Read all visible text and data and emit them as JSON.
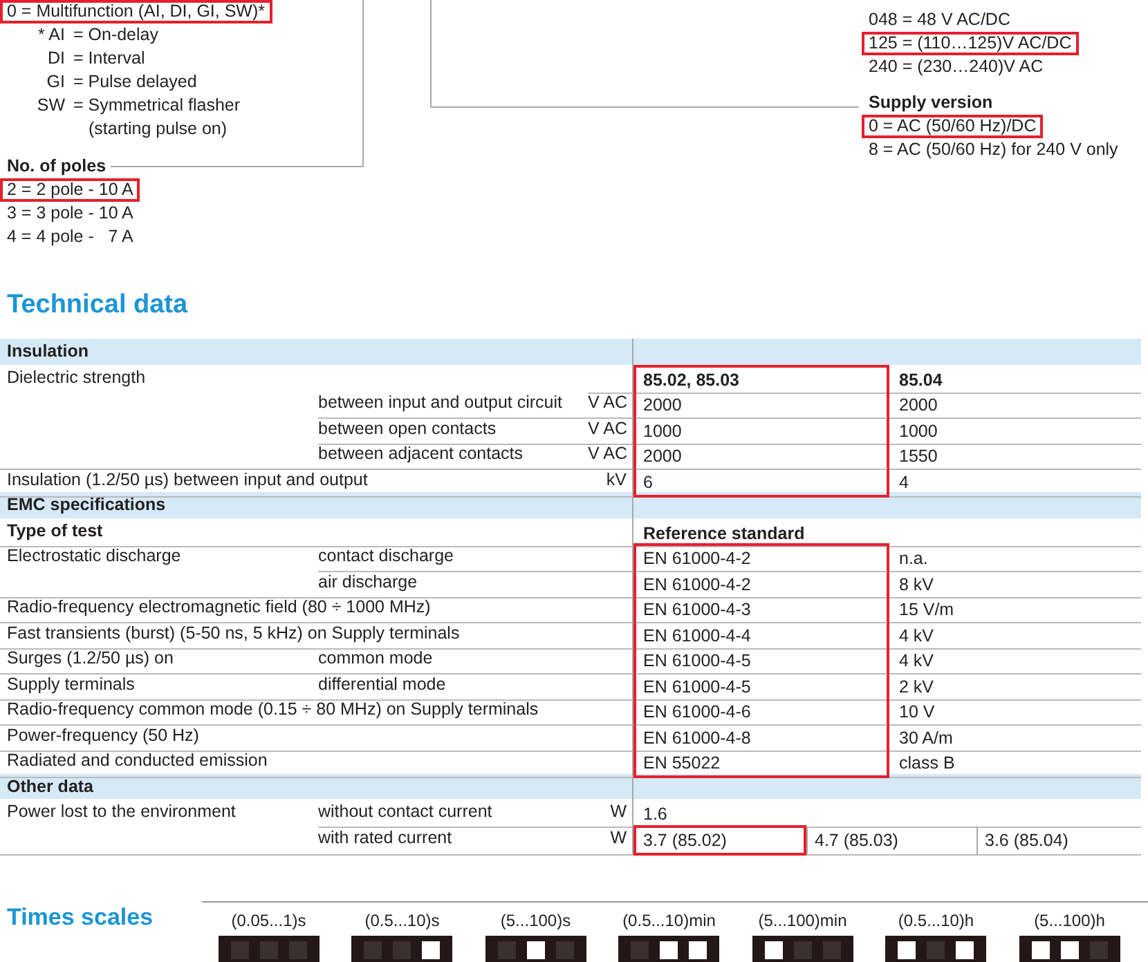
{
  "function_options": [
    {
      "text": "0 = Multifunction (AI, DI, GI, SW)*",
      "highlighted": true
    }
  ],
  "function_notes": [
    {
      "code": "* AI",
      "meaning": "= On-delay"
    },
    {
      "code": "DI",
      "meaning": "= Interval"
    },
    {
      "code": "GI",
      "meaning": "= Pulse delayed"
    },
    {
      "code": "SW",
      "meaning": "= Symmetrical flasher",
      "continuation": "(starting pulse on)"
    }
  ],
  "poles": {
    "title": "No. of poles",
    "options": [
      {
        "text": "2 = 2 pole - 10 A",
        "highlighted": true
      },
      {
        "text": "3 = 3 pole - 10 A",
        "highlighted": false
      },
      {
        "text": "4 = 4 pole -   7 A",
        "highlighted": false
      }
    ]
  },
  "voltage_options": [
    {
      "text": "048 = 48 V AC/DC",
      "highlighted": false
    },
    {
      "text": "125 = (110…125)V AC/DC",
      "highlighted": true
    },
    {
      "text": "240 = (230…240)V AC",
      "highlighted": false
    }
  ],
  "supply_version": {
    "title": "Supply version",
    "options": [
      {
        "text": "0 = AC (50/60 Hz)/DC",
        "highlighted": true
      },
      {
        "text": "8 = AC (50/60 Hz) for 240 V only",
        "highlighted": false
      }
    ]
  },
  "technical_data": {
    "title": "Technical data",
    "rows": [
      {
        "kind": "section",
        "label": "Insulation"
      },
      {
        "kind": "columns",
        "label": "Dielectric strength",
        "values": [
          {
            "text": "85.02, 85.03",
            "highlighted": true
          },
          {
            "text": "85.04",
            "highlighted": false
          }
        ]
      },
      {
        "kind": "data",
        "sub": "between input and output circuit",
        "unit": "V AC",
        "values": [
          {
            "text": "2000",
            "highlighted": true
          },
          {
            "text": "2000",
            "highlighted": false
          }
        ]
      },
      {
        "kind": "data",
        "sub": "between open contacts",
        "unit": "V AC",
        "values": [
          {
            "text": "1000",
            "highlighted": true
          },
          {
            "text": "1000",
            "highlighted": false
          }
        ]
      },
      {
        "kind": "data",
        "sub": "between adjacent contacts",
        "unit": "V AC",
        "values": [
          {
            "text": "2000",
            "highlighted": true
          },
          {
            "text": "1550",
            "highlighted": false
          }
        ]
      },
      {
        "kind": "data",
        "label": "Insulation (1.2/50 µs) between input and output",
        "unit": "kV",
        "values": [
          {
            "text": "6",
            "highlighted": true
          },
          {
            "text": "4",
            "highlighted": false
          }
        ]
      },
      {
        "kind": "section",
        "label": "EMC specifications"
      },
      {
        "kind": "heading",
        "label": "Type of test",
        "values": [
          {
            "text": "Reference standard",
            "highlighted": false
          }
        ]
      },
      {
        "kind": "data",
        "label": "Electrostatic discharge",
        "sub": "contact discharge",
        "values": [
          {
            "text": "EN 61000-4-2",
            "highlighted": true
          },
          {
            "text": "n.a.",
            "highlighted": false
          }
        ]
      },
      {
        "kind": "data",
        "sub": "air discharge",
        "values": [
          {
            "text": "EN 61000-4-2",
            "highlighted": true
          },
          {
            "text": "8 kV",
            "highlighted": false
          }
        ]
      },
      {
        "kind": "data",
        "label": "Radio-frequency electromagnetic field (80 ÷ 1000 MHz)",
        "values": [
          {
            "text": "EN 61000-4-3",
            "highlighted": true
          },
          {
            "text": "15 V/m",
            "highlighted": false
          }
        ]
      },
      {
        "kind": "data",
        "label": "Fast transients (burst) (5-50 ns, 5 kHz) on Supply terminals",
        "values": [
          {
            "text": "EN 61000-4-4",
            "highlighted": true
          },
          {
            "text": "4 kV",
            "highlighted": false
          }
        ]
      },
      {
        "kind": "data",
        "label": "Surges (1.2/50 µs) on",
        "sub": "common mode",
        "values": [
          {
            "text": "EN 61000-4-5",
            "highlighted": true
          },
          {
            "text": "4 kV",
            "highlighted": false
          }
        ]
      },
      {
        "kind": "data",
        "label": "Supply terminals",
        "sub": "differential mode",
        "values": [
          {
            "text": "EN 61000-4-5",
            "highlighted": true
          },
          {
            "text": "2 kV",
            "highlighted": false
          }
        ]
      },
      {
        "kind": "data",
        "label": "Radio-frequency common mode (0.15 ÷ 80 MHz) on Supply terminals",
        "values": [
          {
            "text": "EN 61000-4-6",
            "highlighted": true
          },
          {
            "text": "10 V",
            "highlighted": false
          }
        ]
      },
      {
        "kind": "data",
        "label": "Power-frequency (50 Hz)",
        "values": [
          {
            "text": "EN 61000-4-8",
            "highlighted": true
          },
          {
            "text": "30 A/m",
            "highlighted": false
          }
        ]
      },
      {
        "kind": "data",
        "label": "Radiated and conducted emission",
        "values": [
          {
            "text": "EN 55022",
            "highlighted": true
          },
          {
            "text": "class B",
            "highlighted": false
          }
        ]
      },
      {
        "kind": "section",
        "label": "Other data"
      },
      {
        "kind": "data",
        "label": "Power lost to the environment",
        "sub": "without contact current",
        "unit": "W",
        "values": [
          {
            "text": "1.6",
            "highlighted": false
          }
        ]
      },
      {
        "kind": "data",
        "sub": "with rated current",
        "unit": "W",
        "values": [
          {
            "text": "3.7 (85.02)",
            "highlighted": true
          },
          {
            "text": "4.7 (85.03)",
            "highlighted": false
          },
          {
            "text": "3.6 (85.04)",
            "highlighted": false
          }
        ]
      }
    ]
  },
  "times_scales": {
    "title": "Times scales",
    "scales": [
      {
        "label": "(0.05...1)s",
        "switches_on": [
          false,
          false,
          false
        ]
      },
      {
        "label": "(0.5...10)s",
        "switches_on": [
          false,
          false,
          true
        ]
      },
      {
        "label": "(5...100)s",
        "switches_on": [
          false,
          true,
          false
        ]
      },
      {
        "label": "(0.5...10)min",
        "switches_on": [
          false,
          true,
          true
        ]
      },
      {
        "label": "(5...100)min",
        "switches_on": [
          true,
          false,
          false
        ]
      },
      {
        "label": "(0.5...10)h",
        "switches_on": [
          true,
          false,
          true
        ]
      },
      {
        "label": "(5...100)h",
        "switches_on": [
          true,
          true,
          false
        ]
      }
    ]
  }
}
